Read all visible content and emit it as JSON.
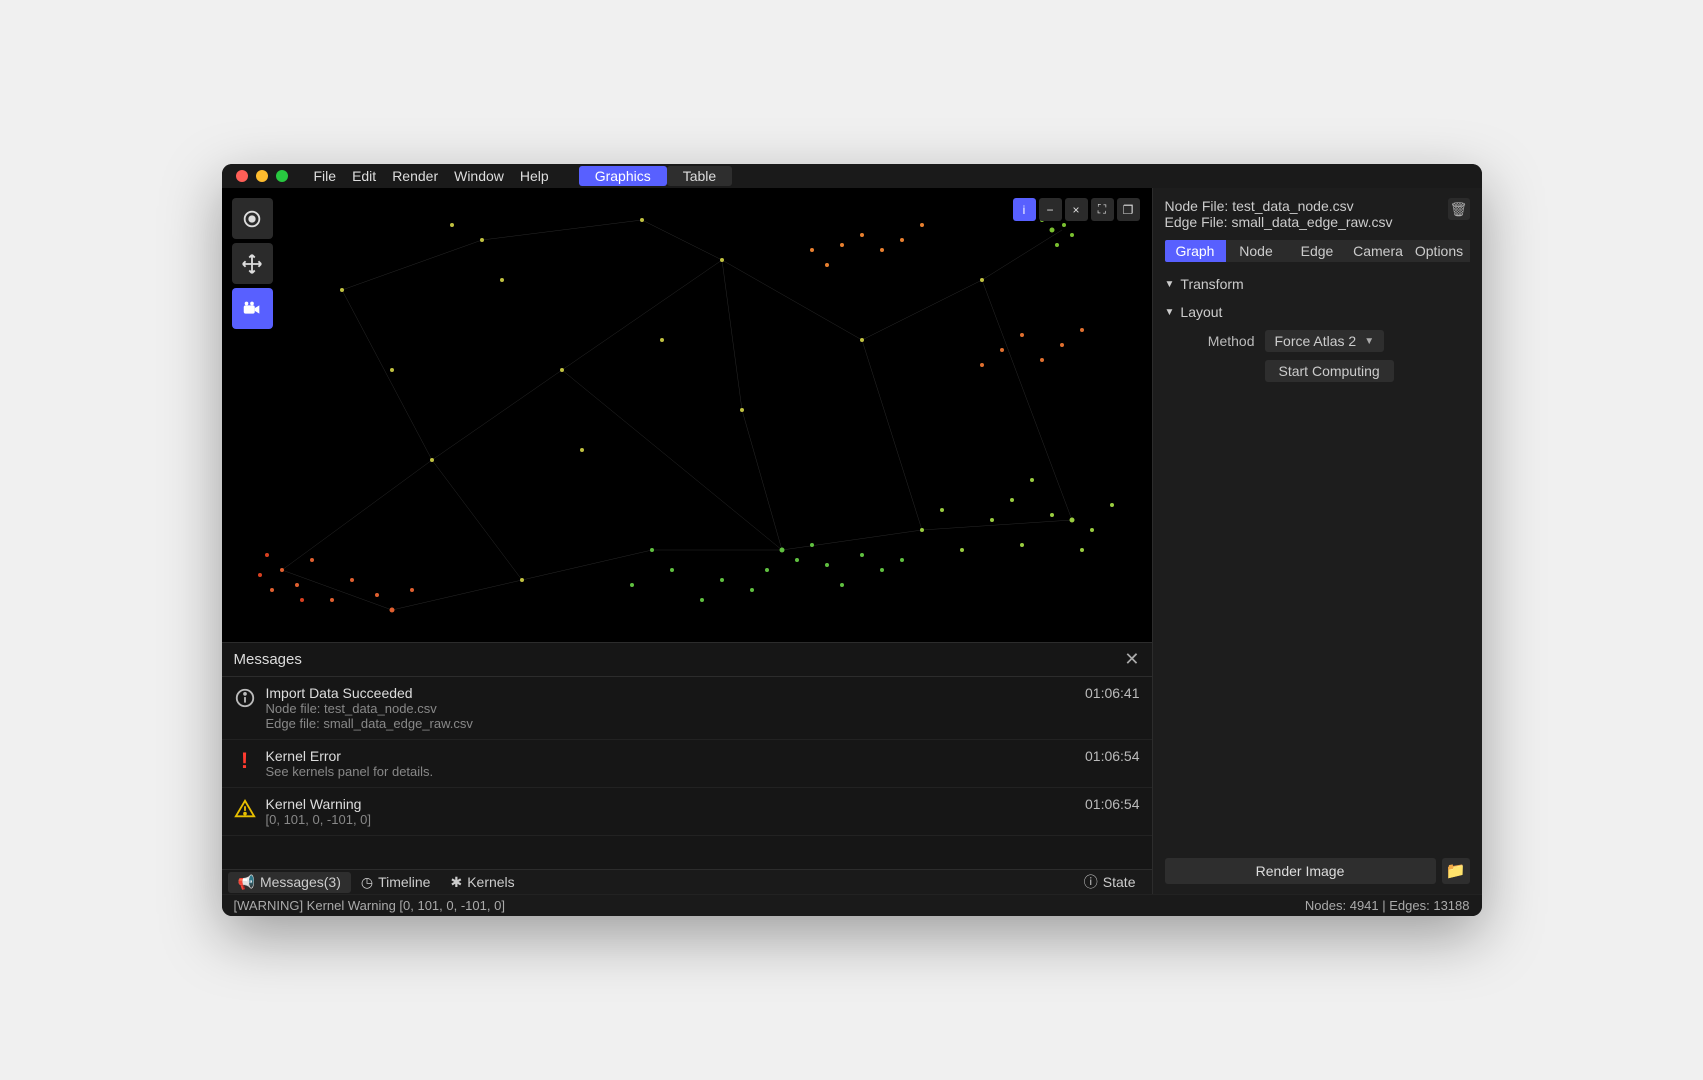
{
  "menubar": {
    "items": [
      "File",
      "Edit",
      "Render",
      "Window",
      "Help"
    ]
  },
  "mode_tabs": {
    "graphics": "Graphics",
    "table": "Table"
  },
  "tools": {
    "select": "select",
    "move": "move",
    "camera": "camera"
  },
  "viewport_buttons": {
    "info": "i",
    "minus": "−",
    "close": "×",
    "fullscreen": "⛶",
    "window": "❐"
  },
  "right": {
    "node_file_label": "Node File: ",
    "node_file": "test_data_node.csv",
    "edge_file_label": "Edge File: ",
    "edge_file": "small_data_edge_raw.csv",
    "tabs": [
      "Graph",
      "Node",
      "Edge",
      "Camera",
      "Options"
    ],
    "sections": {
      "transform": "Transform",
      "layout": "Layout",
      "method_label": "Method",
      "method_value": "Force Atlas 2",
      "start_computing": "Start Computing"
    },
    "render_image": "Render Image"
  },
  "messages_panel": {
    "title": "Messages",
    "items": [
      {
        "icon": "info",
        "title": "Import Data Succeeded",
        "detail1": "Node file: test_data_node.csv",
        "detail2": "Edge file: small_data_edge_raw.csv",
        "time": "01:06:41"
      },
      {
        "icon": "error",
        "title": "Kernel Error",
        "detail1": "See kernels panel for details.",
        "detail2": "",
        "time": "01:06:54"
      },
      {
        "icon": "warning",
        "title": "Kernel Warning",
        "detail1": "[0, 101, 0, -101, 0]",
        "detail2": "",
        "time": "01:06:54"
      }
    ]
  },
  "bottom_tabs": {
    "messages": "Messages(3)",
    "timeline": "Timeline",
    "kernels": "Kernels",
    "state": "State"
  },
  "status": {
    "left": "[WARNING]  Kernel Warning  [0, 101, 0, -101, 0]",
    "nodes_label": "Nodes: ",
    "nodes": "4941",
    "sep": "  |  ",
    "edges_label": "Edges: ",
    "edges": "13188"
  }
}
